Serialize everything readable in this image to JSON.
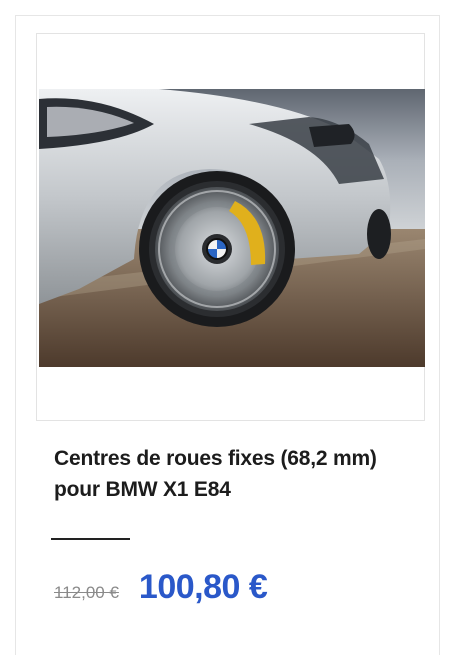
{
  "product": {
    "image_alt": "car-wheel-photo",
    "title": "Centres de roues fixes (68,2 mm) pour BMW X1 E84",
    "old_price": "112,00 €",
    "new_price": "100,80 €"
  },
  "colors": {
    "price_accent": "#2a58c9",
    "old_price": "#8a8a8a",
    "title_text": "#1c1c1c",
    "car_body": "#c9ccd0"
  }
}
